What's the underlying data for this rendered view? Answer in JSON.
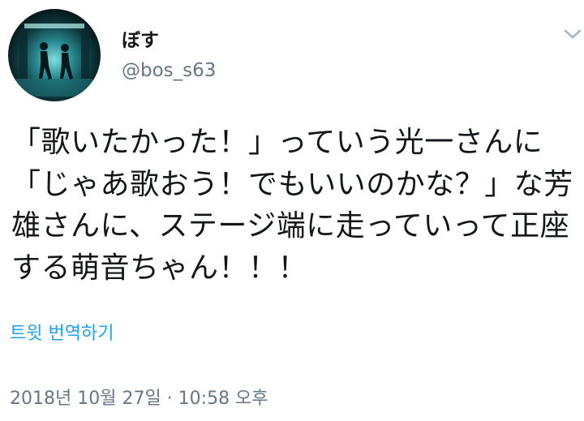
{
  "tweet": {
    "author": {
      "display_name": "ぼす",
      "handle": "@bos_s63",
      "avatar_icon": "avatar-image"
    },
    "menu_icon": "chevron-down-icon",
    "text": "「歌いたかった！」っていう光一さんに「じゃあ歌おう！でもいいのかな？」な芳雄さんに、ステージ端に走っていって正座する萌音ちゃん！！！",
    "translate_label": "트윗 번역하기",
    "timestamp": "2018년 10월 27일 · 10:58 오후"
  },
  "colors": {
    "primary_text": "#14171a",
    "secondary_text": "#657786",
    "link": "#1da1f2",
    "background": "#ffffff",
    "chevron": "#aab8c2"
  }
}
